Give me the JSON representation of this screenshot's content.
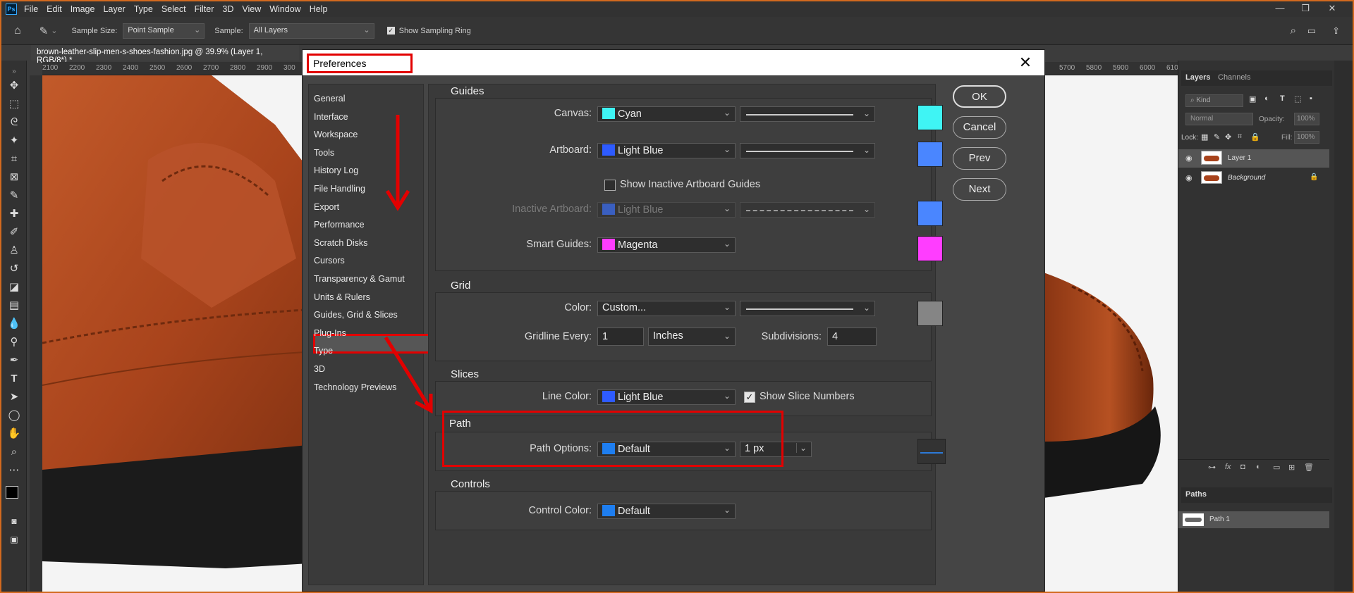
{
  "app": {
    "logo": "Ps",
    "menu": [
      "File",
      "Edit",
      "Image",
      "Layer",
      "Type",
      "Select",
      "Filter",
      "3D",
      "View",
      "Window",
      "Help"
    ]
  },
  "options": {
    "sample_size_label": "Sample Size:",
    "sample_size_value": "Point Sample",
    "sample_label": "Sample:",
    "sample_value": "All Layers",
    "show_ring_label": "Show Sampling Ring"
  },
  "document": {
    "tab_title": "brown-leather-slip-men-s-shoes-fashion.jpg @ 39.9% (Layer 1, RGB/8*) *",
    "ruler_ticks_left": [
      "2100",
      "2200",
      "2300",
      "2400",
      "2500",
      "2600",
      "2700",
      "2800",
      "2900",
      "300"
    ],
    "ruler_ticks_right": [
      "5700",
      "5800",
      "5900",
      "6000",
      "610"
    ]
  },
  "layers_panel": {
    "tabs": [
      "Layers",
      "Channels"
    ],
    "kind": "Kind",
    "blend": "Normal",
    "opacity_label": "Opacity:",
    "opacity": "100%",
    "lock_label": "Lock:",
    "fill_label": "Fill:",
    "fill": "100%",
    "layers": [
      "Layer 1",
      "Background"
    ]
  },
  "paths_panel": {
    "title": "Paths",
    "items": [
      "Path 1"
    ]
  },
  "dialog": {
    "title": "Preferences",
    "nav": [
      "General",
      "Interface",
      "Workspace",
      "Tools",
      "History Log",
      "File Handling",
      "Export",
      "Performance",
      "Scratch Disks",
      "Cursors",
      "Transparency & Gamut",
      "Units & Rulers",
      "Guides, Grid & Slices",
      "Plug-Ins",
      "Type",
      "3D",
      "Technology Previews"
    ],
    "buttons": {
      "ok": "OK",
      "cancel": "Cancel",
      "prev": "Prev",
      "next": "Next"
    },
    "guides": {
      "title": "Guides",
      "canvas_label": "Canvas:",
      "canvas_color": "Cyan",
      "artboard_label": "Artboard:",
      "artboard_color": "Light Blue",
      "show_inactive": "Show Inactive Artboard Guides",
      "inactive_label": "Inactive Artboard:",
      "inactive_color": "Light Blue",
      "smart_label": "Smart Guides:",
      "smart_color": "Magenta"
    },
    "grid": {
      "title": "Grid",
      "color_label": "Color:",
      "color_value": "Custom...",
      "gridline_label": "Gridline Every:",
      "gridline_value": "1",
      "unit": "Inches",
      "subdiv_label": "Subdivisions:",
      "subdiv_value": "4"
    },
    "slices": {
      "title": "Slices",
      "line_color_label": "Line Color:",
      "line_color": "Light Blue",
      "show_numbers": "Show Slice Numbers"
    },
    "path": {
      "title": "Path",
      "options_label": "Path Options:",
      "options_value": "Default",
      "width": "1 px"
    },
    "controls": {
      "title": "Controls",
      "color_label": "Control Color:",
      "color_value": "Default"
    }
  },
  "colors": {
    "cyan": "#3ff4f4",
    "light_blue": "#4a86ff",
    "magenta": "#ff3dff",
    "grid_gray": "#858585",
    "default_blue": "#1e7ef0",
    "highlight_red": "#e20000"
  }
}
